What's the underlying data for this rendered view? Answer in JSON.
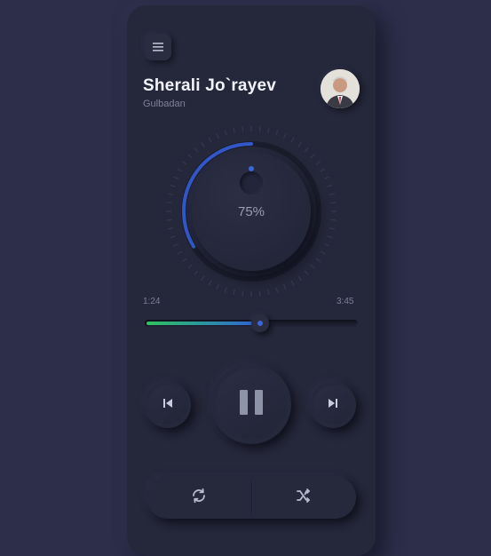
{
  "player": {
    "artist": "Sherali Jo`rayev",
    "song": "Gulbadan",
    "volume_label": "75%",
    "volume_fraction": 0.75,
    "time_current": "1:24",
    "time_total": "3:45",
    "progress_fraction": 0.54
  },
  "icons": {
    "menu": "menu-icon",
    "prev": "skip-previous-icon",
    "play_pause": "pause-icon",
    "next": "skip-next-icon",
    "repeat": "repeat-icon",
    "shuffle": "shuffle-icon"
  },
  "colors": {
    "background": "#2d2e4a",
    "panel": "#25273a",
    "accent_blue": "#3a66d8",
    "accent_green": "#2fc35c",
    "text_primary": "#f2f3f8",
    "text_secondary": "#7f8299"
  }
}
